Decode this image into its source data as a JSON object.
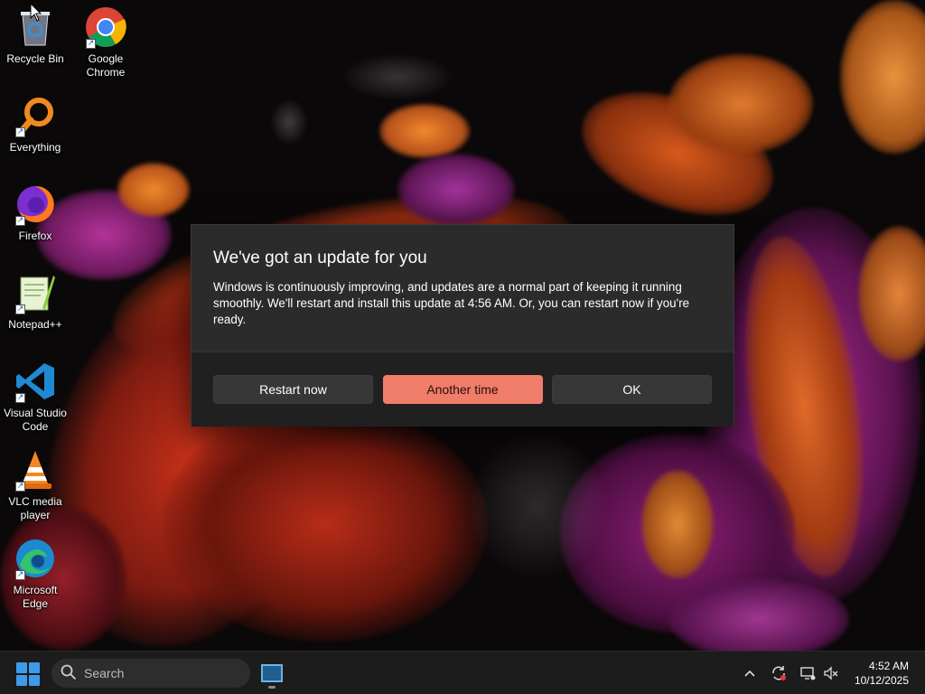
{
  "desktop": {
    "icons": [
      {
        "label": "Recycle Bin"
      },
      {
        "label": "Google Chrome"
      },
      {
        "label": "Everything"
      },
      {
        "label": "Firefox"
      },
      {
        "label": "Notepad++"
      },
      {
        "label": "Visual Studio Code"
      },
      {
        "label": "VLC media player"
      },
      {
        "label": "Microsoft Edge"
      }
    ]
  },
  "dialog": {
    "title": "We've got an update for you",
    "message": "Windows is continuously improving, and updates are a normal part of keeping it running smoothly. We'll restart and install this update at 4:56 AM. Or, you can restart now if you're ready.",
    "buttons": {
      "restart_now": "Restart now",
      "another_time": "Another time",
      "ok": "OK"
    },
    "accent_color": "#f07c6a"
  },
  "taskbar": {
    "search_placeholder": "Search",
    "clock": {
      "time": "4:52 AM",
      "date": "10/12/2025"
    },
    "tray_icons": [
      "chevron-up-icon",
      "update-icon",
      "network-icon",
      "volume-icon"
    ]
  }
}
